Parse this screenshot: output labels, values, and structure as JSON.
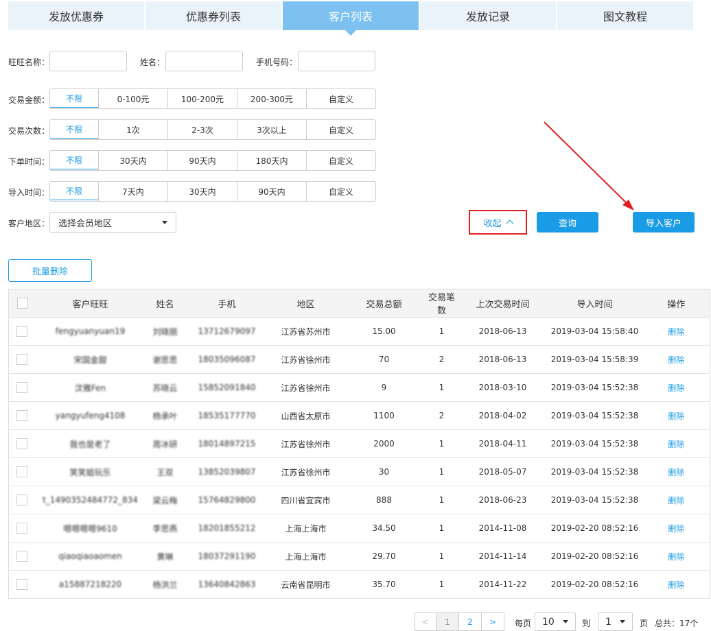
{
  "tabs": [
    {
      "label": "发放优惠券"
    },
    {
      "label": "优惠券列表"
    },
    {
      "label": "客户列表"
    },
    {
      "label": "发放记录"
    },
    {
      "label": "图文教程"
    }
  ],
  "active_tab": "客户列表",
  "filters": {
    "wangwang_label": "旺旺名称：",
    "name_label": "姓名：",
    "phone_label": "手机号码：",
    "wangwang_value": "",
    "name_value": "",
    "phone_value": "",
    "amount": {
      "label": "交易金额：",
      "options": [
        "不限",
        "0-100元",
        "100-200元",
        "200-300元",
        "自定义"
      ]
    },
    "count": {
      "label": "交易次数：",
      "options": [
        "不限",
        "1次",
        "2-3次",
        "3次以上",
        "自定义"
      ]
    },
    "order_time": {
      "label": "下单时间：",
      "options": [
        "不限",
        "30天内",
        "90天内",
        "180天内",
        "自定义"
      ]
    },
    "import_time": {
      "label": "导入时间：",
      "options": [
        "不限",
        "7天内",
        "30天内",
        "90天内",
        "自定义"
      ]
    },
    "region": {
      "label": "客户地区：",
      "selected": "选择会员地区"
    }
  },
  "actions": {
    "collapse": "收起",
    "query": "查询",
    "import": "导入客户",
    "batch_delete": "批量删除"
  },
  "colors": {
    "accent": "#1a9be6",
    "active_tab": "#7cc1ef",
    "highlight": "#e02020"
  },
  "table": {
    "headers": [
      "客户旺旺",
      "姓名",
      "手机",
      "地区",
      "交易总额",
      "交易笔数",
      "上次交易时间",
      "导入时间",
      "操作"
    ],
    "rows": [
      {
        "ww": "fengyuanyuan19",
        "name": "刘晓丽",
        "phone": "13712679097",
        "region": "江苏省苏州市",
        "total": "15.00",
        "count": "1",
        "last": "2018-06-13",
        "imported": "2019-03-04 15:58:40",
        "op": "删除"
      },
      {
        "ww": "宋国金甜",
        "name": "谢思思",
        "phone": "18035096087",
        "region": "江苏省徐州市",
        "total": "70",
        "count": "2",
        "last": "2018-06-13",
        "imported": "2019-03-04 15:58:39",
        "op": "删除"
      },
      {
        "ww": "汶雅Fen",
        "name": "苏晓云",
        "phone": "15852091840",
        "region": "江苏省徐州市",
        "total": "9",
        "count": "1",
        "last": "2018-03-10",
        "imported": "2019-03-04 15:52:38",
        "op": "删除"
      },
      {
        "ww": "yangyufeng4108",
        "name": "杨承叶",
        "phone": "18535177770",
        "region": "山西省太原市",
        "total": "1100",
        "count": "2",
        "last": "2018-04-02",
        "imported": "2019-03-04 15:52:38",
        "op": "删除"
      },
      {
        "ww": "我也是老了",
        "name": "周冰研",
        "phone": "18014897215",
        "region": "江苏省徐州市",
        "total": "2000",
        "count": "1",
        "last": "2018-04-11",
        "imported": "2019-03-04 15:52:38",
        "op": "删除"
      },
      {
        "ww": "笑笑姐玩乐",
        "name": "王双",
        "phone": "13852039807",
        "region": "江苏省徐州市",
        "total": "30",
        "count": "1",
        "last": "2018-05-07",
        "imported": "2019-03-04 15:52:38",
        "op": "删除"
      },
      {
        "ww": "t_1490352484772_834",
        "name": "梁云梅",
        "phone": "15764829800",
        "region": "四川省宜宾市",
        "total": "888",
        "count": "1",
        "last": "2018-06-23",
        "imported": "2019-03-04 15:52:38",
        "op": "删除"
      },
      {
        "ww": "嗯嗯嗯嗯9610",
        "name": "李思燕",
        "phone": "18201855212",
        "region": "上海上海市",
        "total": "34.50",
        "count": "1",
        "last": "2014-11-08",
        "imported": "2019-02-20 08:52:16",
        "op": "删除"
      },
      {
        "ww": "qiaoqiaoaomen",
        "name": "黄琳",
        "phone": "18037291190",
        "region": "上海上海市",
        "total": "29.70",
        "count": "1",
        "last": "2014-11-14",
        "imported": "2019-02-20 08:52:16",
        "op": "删除"
      },
      {
        "ww": "a15887218220",
        "name": "杨洪兰",
        "phone": "13640842863",
        "region": "云南省昆明市",
        "total": "35.70",
        "count": "1",
        "last": "2014-11-22",
        "imported": "2019-02-20 08:52:16",
        "op": "删除"
      }
    ]
  },
  "pagination": {
    "prev": "<",
    "pages": [
      "1",
      "2"
    ],
    "current": "1",
    "next": ">",
    "per_page_label": "每页",
    "per_page": "10",
    "goto_label": "到",
    "goto_page": "1",
    "page_label": "页",
    "total": "总共：17个"
  }
}
